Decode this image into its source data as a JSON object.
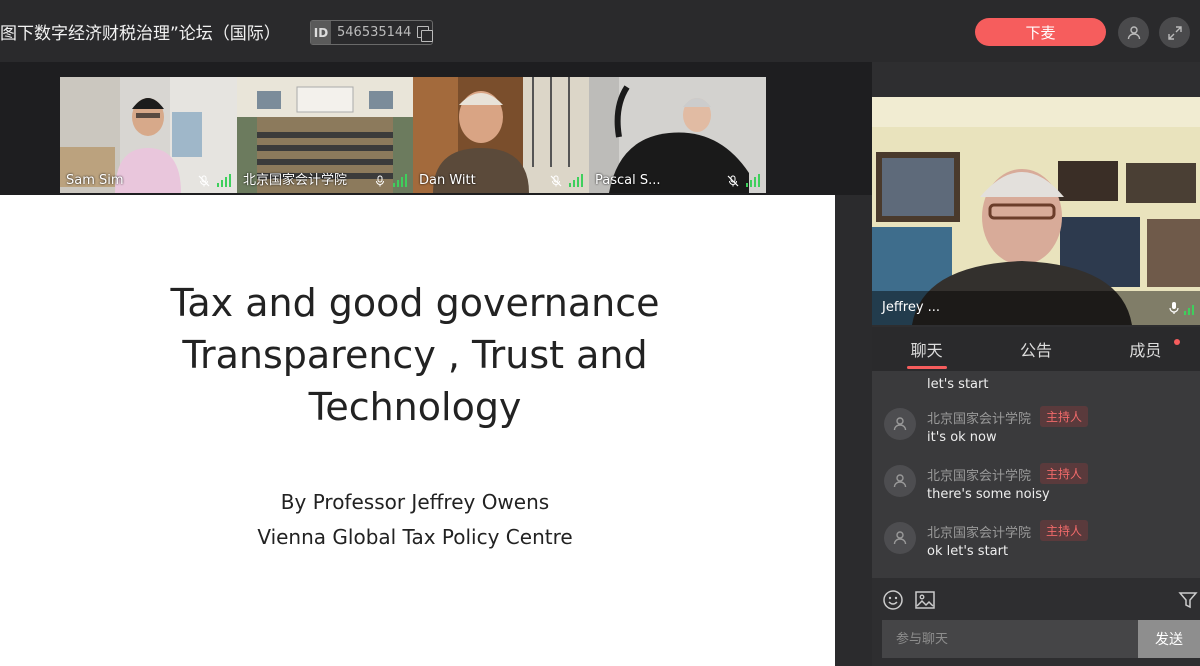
{
  "header": {
    "title": "图下数字经济财税治理”论坛（国际）",
    "id_label": "ID",
    "meeting_id": "546535144",
    "leave_label": "下麦"
  },
  "participants": [
    {
      "name": "Sam Sim"
    },
    {
      "name": "北京国家会计学院"
    },
    {
      "name": "Dan Witt"
    },
    {
      "name": "Pascal S..."
    }
  ],
  "slide": {
    "title_lines": [
      "Tax and good governance",
      "Transparency , Trust and",
      "Technology"
    ],
    "sub_lines": [
      "By  Professor Jeffrey Owens",
      "Vienna Global Tax Policy Centre"
    ]
  },
  "speaker": {
    "name": "Jeffrey ..."
  },
  "tabs": [
    {
      "label": "聊天",
      "active": true
    },
    {
      "label": "公告",
      "active": false
    },
    {
      "label": "成员",
      "active": false
    }
  ],
  "chat": {
    "partial_text": "let's start",
    "messages": [
      {
        "sender": "北京国家会计学院",
        "badge": "主持人",
        "text": "it's ok now"
      },
      {
        "sender": "北京国家会计学院",
        "badge": "主持人",
        "text": "there's some noisy"
      },
      {
        "sender": "北京国家会计学院",
        "badge": "主持人",
        "text": "ok let's start"
      }
    ],
    "placeholder": "参与聊天",
    "send_label": "发送"
  },
  "colors": {
    "accent": "#f65d5d",
    "audio": "#3ecf5c"
  }
}
